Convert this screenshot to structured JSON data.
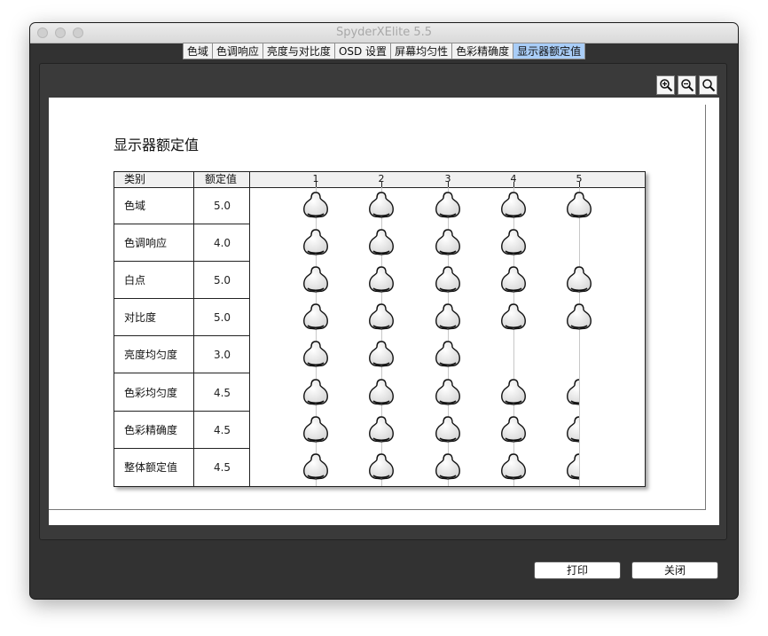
{
  "window": {
    "title": "SpyderXElite 5.5"
  },
  "tabs": [
    {
      "label": "色域",
      "active": false
    },
    {
      "label": "色调响应",
      "active": false
    },
    {
      "label": "亮度与对比度",
      "active": false
    },
    {
      "label": "OSD 设置",
      "active": false
    },
    {
      "label": "屏幕均匀性",
      "active": false
    },
    {
      "label": "色彩精确度",
      "active": false
    },
    {
      "label": "显示器额定值",
      "active": true
    }
  ],
  "zoom_controls": [
    "zoom-in-icon",
    "zoom-out-icon",
    "zoom-fit-icon"
  ],
  "report": {
    "title": "显示器额定值",
    "headers": {
      "category": "类别",
      "rating": "额定值"
    },
    "scale": [
      "1",
      "2",
      "3",
      "4",
      "5"
    ],
    "rows": [
      {
        "category": "色域",
        "rating": "5.0",
        "value": 5.0
      },
      {
        "category": "色调响应",
        "rating": "4.0",
        "value": 4.0
      },
      {
        "category": "白点",
        "rating": "5.0",
        "value": 5.0
      },
      {
        "category": "对比度",
        "rating": "5.0",
        "value": 5.0
      },
      {
        "category": "亮度均匀度",
        "rating": "3.0",
        "value": 3.0
      },
      {
        "category": "色彩均匀度",
        "rating": "4.5",
        "value": 4.5
      },
      {
        "category": "色彩精确度",
        "rating": "4.5",
        "value": 4.5
      },
      {
        "category": "整体额定值",
        "rating": "4.5",
        "value": 4.5
      }
    ]
  },
  "buttons": {
    "print": "打印",
    "close": "关闭"
  }
}
